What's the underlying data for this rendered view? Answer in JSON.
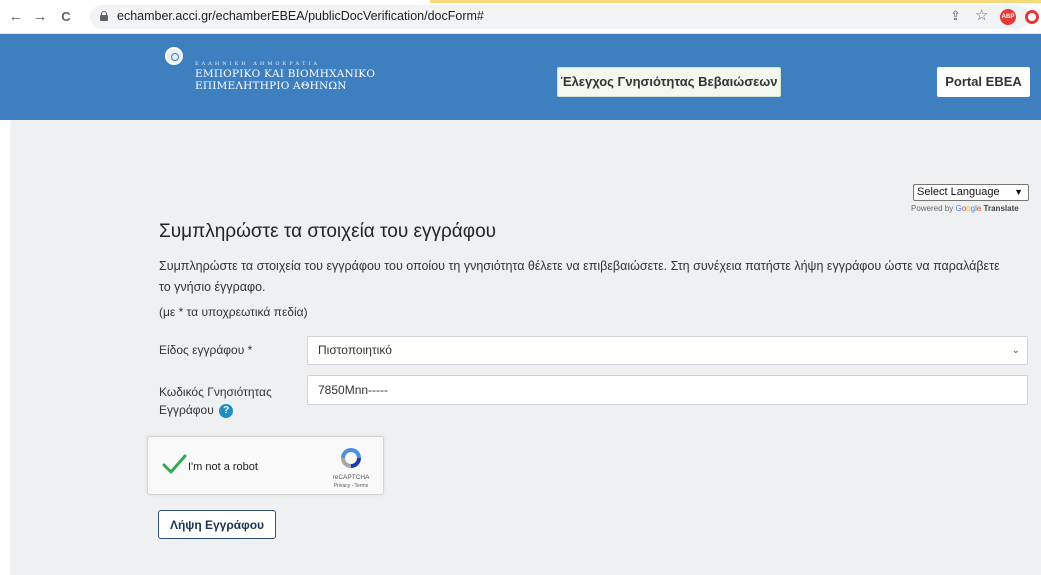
{
  "browser": {
    "url": "echamber.acci.gr/echamberEBEA/publicDocVerification/docForm#",
    "back_icon": "←",
    "forward_icon": "→",
    "reload_icon": "C",
    "share_icon": "⇪",
    "star_icon": "☆",
    "ext_abp": "ABP"
  },
  "header": {
    "logo_small": "ΕΛΛΗΝΙΚΗ ΔΗΜΟΚΡΑΤΙΑ",
    "logo_line1": "ΕΜΠΟΡΙΚΟ ΚΑΙ ΒΙΟΜΗΧΑΝΙΚΟ",
    "logo_line2": "ΕΠΙΜΕΛΗΤΗΡΙΟ ΑΘΗΝΩΝ",
    "verify_button": "Έλεγχος Γνησιότητας Βεβαιώσεων",
    "portal_button": "Portal ΕΒΕΑ"
  },
  "translate": {
    "select_label": "Select Language",
    "powered_by": "Powered by",
    "google": [
      "G",
      "o",
      "o",
      "g",
      "l",
      "e"
    ],
    "translate_word": "Translate"
  },
  "form": {
    "title": "Συμπληρώστε τα στοιχεία του εγγράφου",
    "description": "Συμπληρώστε τα στοιχεία του εγγράφου του οποίου τη γνησιότητα θέλετε να επιβεβαιώσετε. Στη συνέχεια πατήστε λήψη εγγράφου ώστε να παραλάβετε το γνήσιο έγγραφο.",
    "required_note": "(με * τα υποχρεωτικά πεδία)",
    "doc_type_label": "Είδος εγγράφου *",
    "doc_type_value": "Πιστοποιητικό",
    "code_label": "Κωδικός Γνησιότητας Εγγράφου",
    "code_value": "7850Mnn-----",
    "help_icon": "?",
    "download_button": "Λήψη Εγγράφου"
  },
  "recaptcha": {
    "label": "I'm not a robot",
    "brand": "reCAPTCHA",
    "terms": "Privacy - Terms"
  },
  "colors": {
    "header_bg": "#3e7fbf",
    "content_bg": "#eef0f1",
    "help_icon": "#1f8fc1",
    "check": "#35a853"
  }
}
